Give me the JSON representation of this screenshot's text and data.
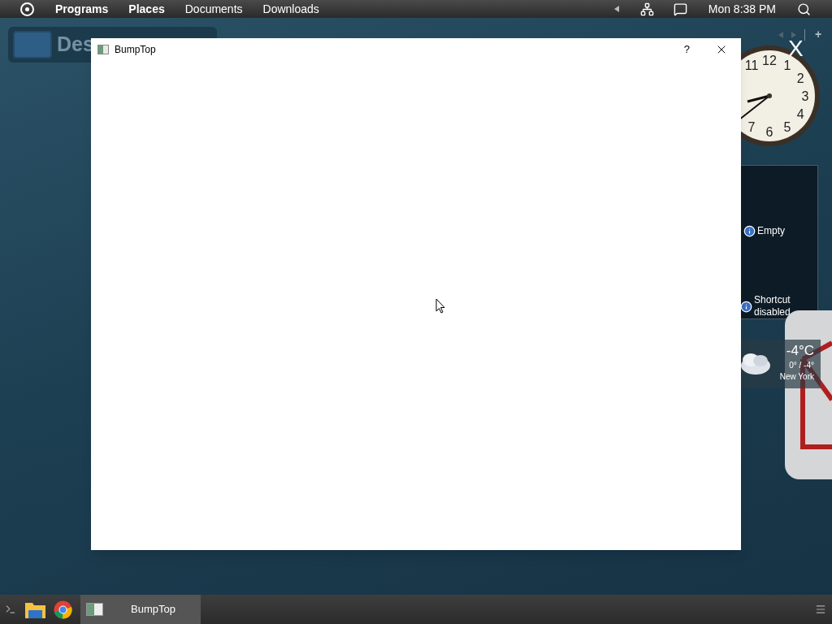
{
  "top_bar": {
    "menus": [
      {
        "label": "Programs",
        "bold": true
      },
      {
        "label": "Places",
        "bold": true
      },
      {
        "label": "Documents",
        "bold": false
      },
      {
        "label": "Downloads",
        "bold": false
      }
    ],
    "clock": "Mon 8:38 PM"
  },
  "desktop_label": "Des",
  "window": {
    "title": "BumpTop",
    "help": "?"
  },
  "clock_gadget": {
    "numerals": [
      "12",
      "11",
      "1",
      "2",
      "3",
      "4",
      "7",
      "5",
      "6"
    ],
    "close": "X",
    "add": "+"
  },
  "info_gadget": {
    "items": [
      "Empty",
      "Shortcut disabled"
    ]
  },
  "weather": {
    "temperature": "-4°C",
    "range": "0° / -4°",
    "city": "New York"
  },
  "taskbar": {
    "items": [
      {
        "label": "BumpTop",
        "selected": true
      }
    ]
  }
}
